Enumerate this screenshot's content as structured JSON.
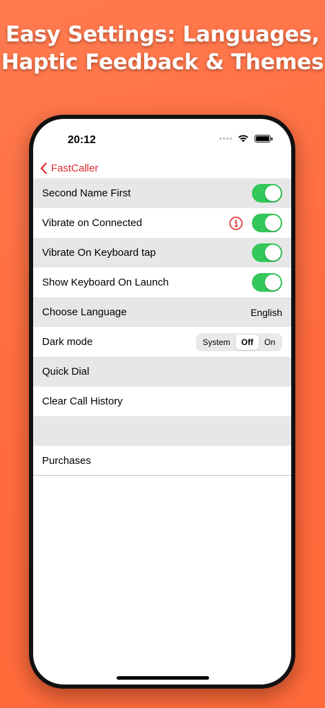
{
  "headline": {
    "line1": "Easy Settings: Languages,",
    "line2": "Haptic Feedback & Themes"
  },
  "status_bar": {
    "time": "20:12",
    "icons": [
      "signal-dots-icon",
      "wifi-icon",
      "battery-icon"
    ]
  },
  "nav": {
    "back_label": "FastCaller",
    "back_icon": "chevron-left-icon"
  },
  "settings": {
    "second_name_first": {
      "label": "Second Name First",
      "enabled": true
    },
    "vibrate_connected": {
      "label": "Vibrate on Connected",
      "enabled": true,
      "info_icon": "info-icon"
    },
    "vibrate_keyboard": {
      "label": "Vibrate On Keyboard tap",
      "enabled": true
    },
    "show_keyboard": {
      "label": "Show Keyboard On Launch",
      "enabled": true
    },
    "language": {
      "label": "Choose Language",
      "value": "English"
    },
    "dark_mode": {
      "label": "Dark mode",
      "options": [
        "System",
        "Off",
        "On"
      ],
      "selected": "Off"
    },
    "quick_dial": {
      "label": "Quick Dial"
    },
    "clear_history": {
      "label": "Clear Call History"
    },
    "purchases": {
      "label": "Purchases"
    }
  },
  "colors": {
    "background": "#ff6d3f",
    "accent": "#e0282f",
    "toggle_on": "#34c759",
    "row_gray": "#e7e7e7"
  }
}
